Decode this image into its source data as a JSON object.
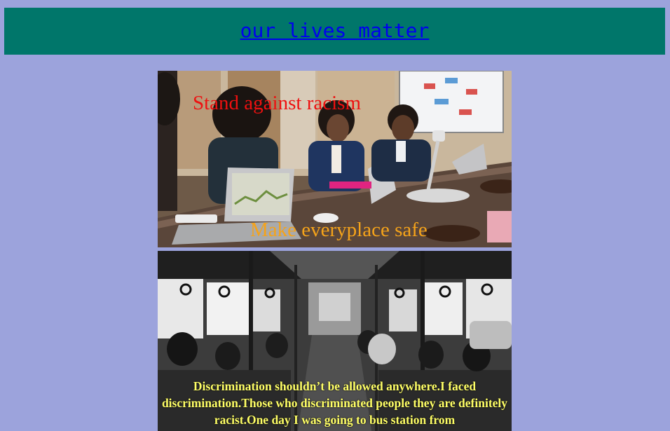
{
  "header": {
    "title_link": "our lives matter",
    "background": "#00766a",
    "link_color": "#0000ee"
  },
  "page": {
    "background": "#9ca3dc"
  },
  "photo1": {
    "overlay_top": "Stand against racism",
    "overlay_bottom": "Make everyplace safe",
    "overlay_top_color": "#ee1010",
    "overlay_bottom_color": "#f5a31a"
  },
  "photo2": {
    "caption": "Discrimination shouldn’t be allowed anywhere.I faced discrimination.Those who discriminated people they are definitely racist.One day I was going to bus station from",
    "caption_color": "#ffff66"
  }
}
